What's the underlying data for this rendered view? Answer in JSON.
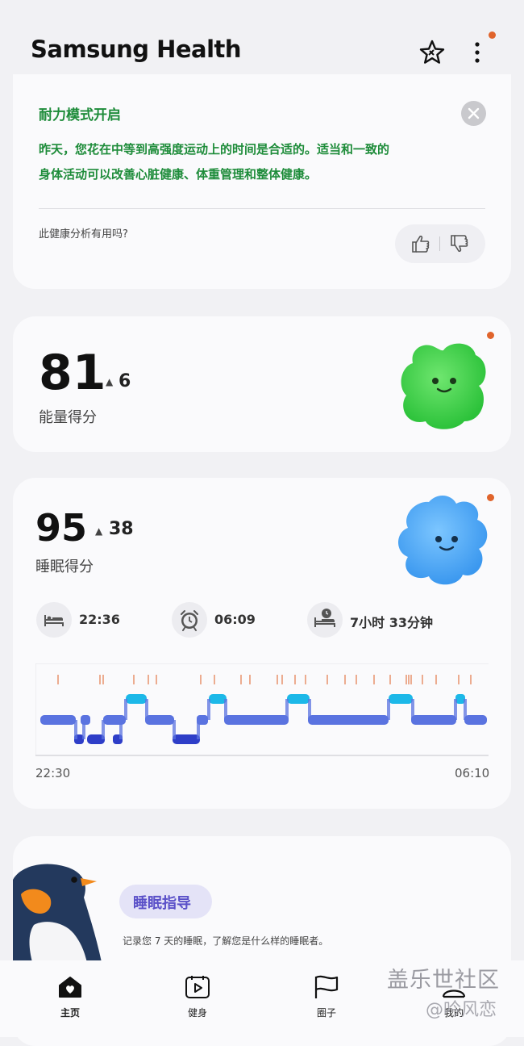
{
  "header": {
    "title": "Samsung Health"
  },
  "insight_card": {
    "title": "耐力模式开启",
    "body_line1": "昨天，您花在中等到高强度运动上的时间是合适的。适当和一致的",
    "body_line2": "身体活动可以改善心脏健康、体重管理和整体健康。",
    "feedback_question": "此健康分析有用吗?"
  },
  "energy": {
    "score": "81",
    "delta_arrow": "▲",
    "delta": "6",
    "label": "能量得分"
  },
  "sleep": {
    "score": "95",
    "delta_arrow": "▲",
    "delta": "38",
    "label": "睡眠得分",
    "bedtime": "22:36",
    "wake_time": "06:09",
    "duration": "7小时 33分钟",
    "chart_start": "22:30",
    "chart_end": "06:10"
  },
  "coach": {
    "title": "睡眠指导",
    "desc": "记录您 7 天的睡眠，了解您是什么样的睡眠者。"
  },
  "nav": {
    "home": "主页",
    "fitness": "健身",
    "together": "圈子",
    "my": "我的"
  },
  "watermark": {
    "line1": "盖乐世社区",
    "line2": "@吟风恋"
  },
  "colors": {
    "accent_green": "#1e8c3a",
    "notify_dot": "#e0642c",
    "coach_purple": "#5a50c8",
    "sleep_light": "#1cb8e8",
    "sleep_deep": "#2e3ec8"
  }
}
